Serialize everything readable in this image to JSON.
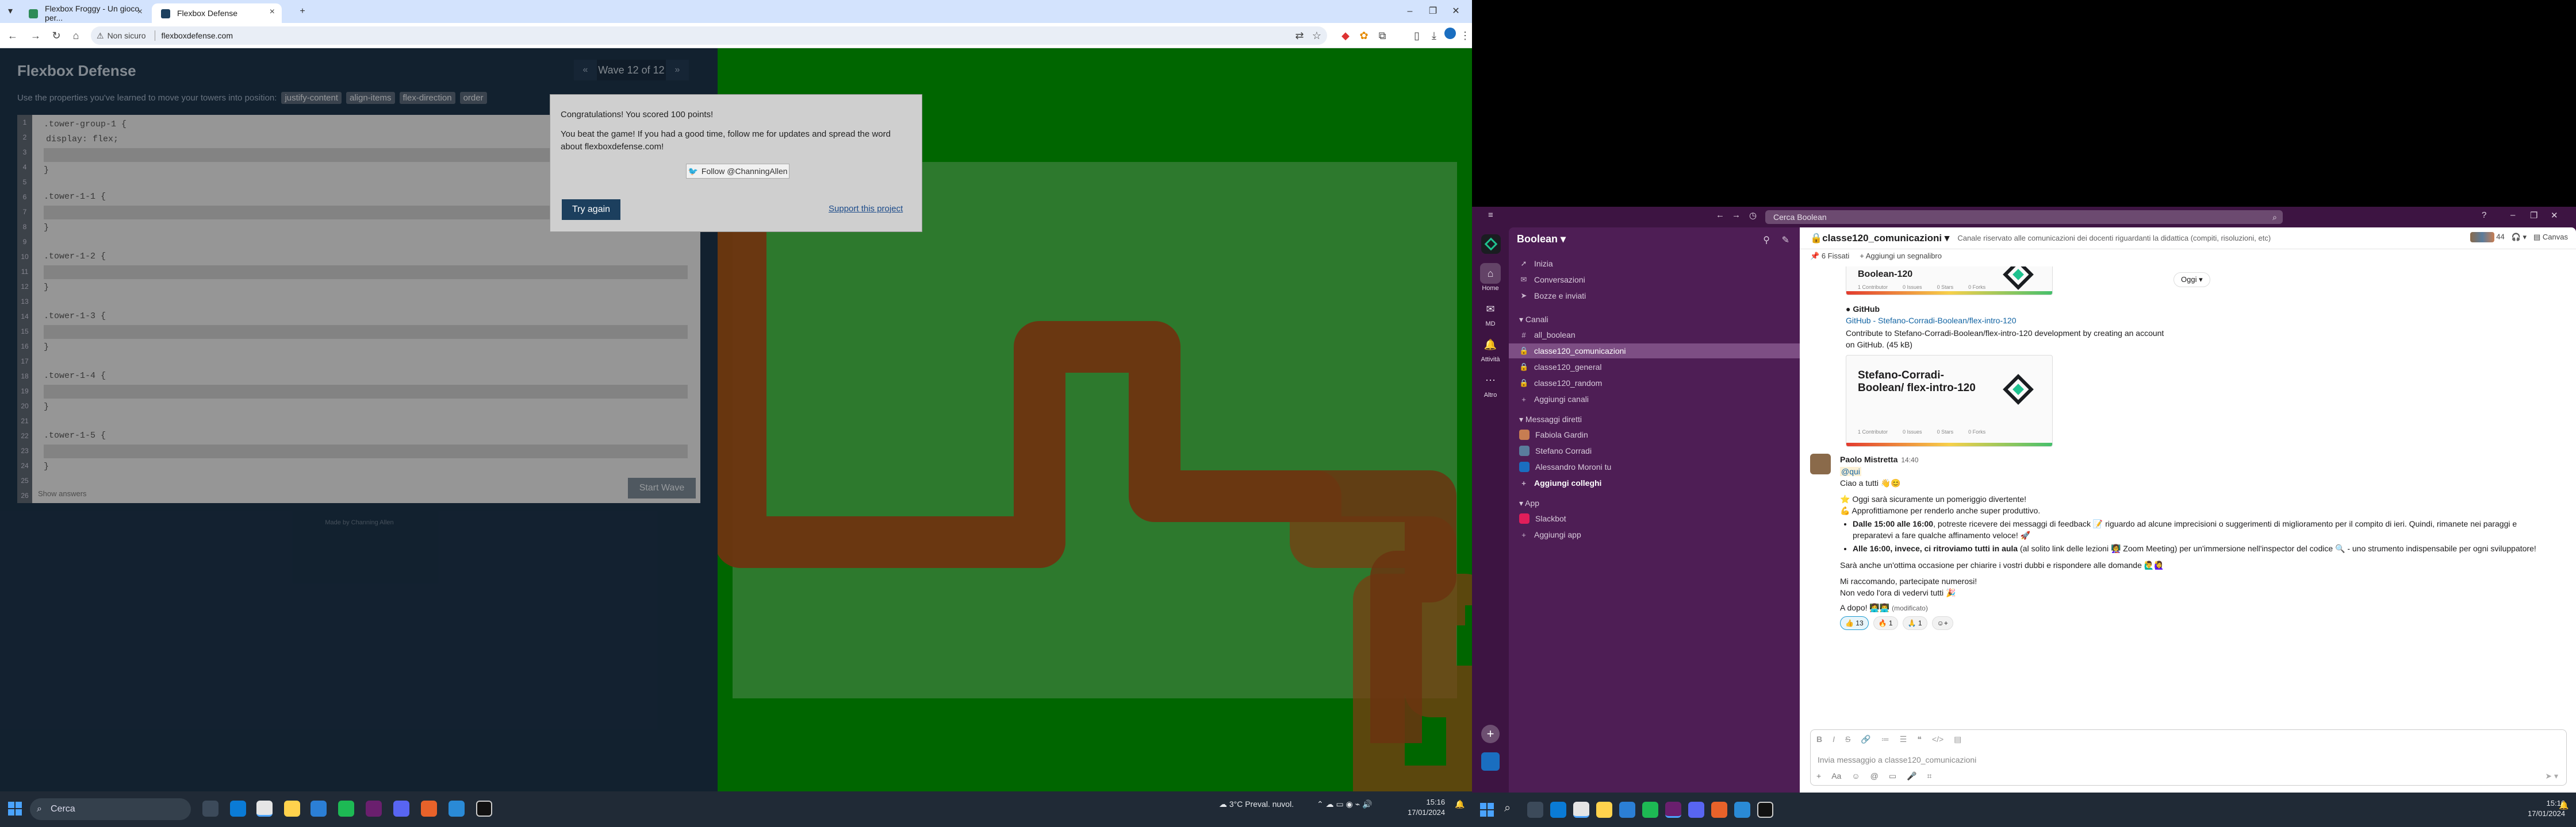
{
  "browser": {
    "tabs": [
      {
        "title": "Flexbox Froggy - Un gioco per...",
        "active": false
      },
      {
        "title": "Flexbox Defense",
        "active": true
      }
    ],
    "new_tab": "+",
    "security_label": "Non sicuro",
    "url": "flexboxdefense.com"
  },
  "game": {
    "title": "Flexbox Defense",
    "wave_label": "Wave 12 of 12",
    "prev": "«",
    "next": "»",
    "instructions": "Use the properties you've learned to move your towers into position:",
    "properties": [
      "justify-content",
      "align-items",
      "flex-direction",
      "order"
    ],
    "code_groups": [
      {
        "line1": ".tower-group-1 {",
        "line2": "display: flex;"
      },
      {
        "line1": ".tower-1-1 {",
        "line2": ""
      },
      {
        "line1": ".tower-1-2 {",
        "line2": ""
      },
      {
        "line1": ".tower-1-3 {",
        "line2": ""
      },
      {
        "line1": ".tower-1-4 {",
        "line2": ""
      },
      {
        "line1": ".tower-1-5 {",
        "line2": ""
      }
    ],
    "close_brace": "}",
    "start_wave": "Start Wave",
    "show_answers": "Show answers",
    "credit": "Made by Channing Allen"
  },
  "modal": {
    "line1": "Congratulations! You scored 100 points!",
    "line2": "You beat the game! If you had a good time, follow me for updates and spread the word about flexboxdefense.com!",
    "follow_label": "Follow @ChanningAllen",
    "try_again": "Try again",
    "support": "Support this project"
  },
  "taskbar_left": {
    "search": "Cerca",
    "weather": "3°C  Preval. nuvol.",
    "time": "15:16",
    "date": "17/01/2024"
  },
  "slack": {
    "search": "Cerca Boolean",
    "workspace": "Boolean",
    "rail": [
      {
        "label": "Home",
        "icon": "⌂"
      },
      {
        "label": "MD",
        "icon": "✉"
      },
      {
        "label": "Attività",
        "icon": "🔔"
      },
      {
        "label": "Altro",
        "icon": "⋯"
      }
    ],
    "nav": [
      "Inizia",
      "Conversazioni",
      "Bozze e inviati"
    ],
    "channels_heading": "Canali",
    "channels": [
      "all_boolean",
      "classe120_comunicazioni",
      "classe120_general",
      "classe120_random"
    ],
    "add_channels": "Aggiungi canali",
    "dm_heading": "Messaggi diretti",
    "dms": [
      "Fabiola Gardin",
      "Stefano Corradi",
      "Alessandro Moroni  tu"
    ],
    "add_colleagues": "Aggiungi colleghi",
    "app_heading": "App",
    "apps": [
      "Slackbot"
    ],
    "add_app": "Aggiungi app",
    "channel_name": "classe120_comunicazioni",
    "channel_desc": "Canale riservato alle comunicazioni dei docenti riguardanti la didattica (compiti, risoluzioni, etc)",
    "member_count": "44",
    "canvas": "Canvas",
    "pinned": "6 Fissati",
    "add_bookmark": "Aggiungi un segnalibro",
    "day_divider": "Oggi",
    "card_title": "Stefano-Corradi-Boolean/ flex-intro-120",
    "card_title_top": "Boolean-120",
    "card_stats": [
      "1 Contributor",
      "0 Issues",
      "0 Stars",
      "0 Forks"
    ],
    "gh_source": "GitHub",
    "gh_link": "GitHub - Stefano-Corradi-Boolean/flex-intro-120",
    "gh_desc": "Contribute to Stefano-Corradi-Boolean/flex-intro-120 development by creating an account on GitHub. (45 kB)",
    "post": {
      "author": "Paolo Mistretta",
      "time": "14:40",
      "mention": "@qui",
      "greeting": "Ciao a tutti 👋😊",
      "l1": "⭐ Oggi sarà sicuramente un pomeriggio divertente!",
      "l2": "💪 Approfittiamone per renderlo anche super produttivo.",
      "b1_bold": "Dalle 15:00 alle 16:00",
      "b1": ", potreste ricevere dei messaggi di feedback 📝 riguardo ad alcune imprecisioni o suggerimenti di miglioramento per il compito di ieri. Quindi, rimanete nei paraggi e preparatevi a fare qualche affinamento veloce! 🚀",
      "b2_bold": "Alle 16:00, invece, ci ritroviamo tutti in aula",
      "b2": " (al solito link delle lezioni 👩‍🏫 Zoom Meeting) per un'immersione nell'inspector del codice 🔍 - uno strumento indispensabile per ogni sviluppatore!",
      "l3": "Sarà anche un'ottima occasione per chiarire i vostri dubbi e rispondere alle domande 🙋‍♂️🙋‍♀️",
      "l4": "Mi raccomando, partecipate numerosi!",
      "l5": "Non vedo l'ora di vedervi tutti 🎉",
      "l6": "A dopo! 👩‍💻👨‍💻",
      "edited": "(modificato)",
      "reactions": [
        "👍 13",
        "🔥 1",
        "🙏 1"
      ]
    },
    "composer_placeholder": "Invia messaggio a classe120_comunicazioni"
  },
  "taskbar_right": {
    "time": "15:16",
    "date": "17/01/2024"
  }
}
